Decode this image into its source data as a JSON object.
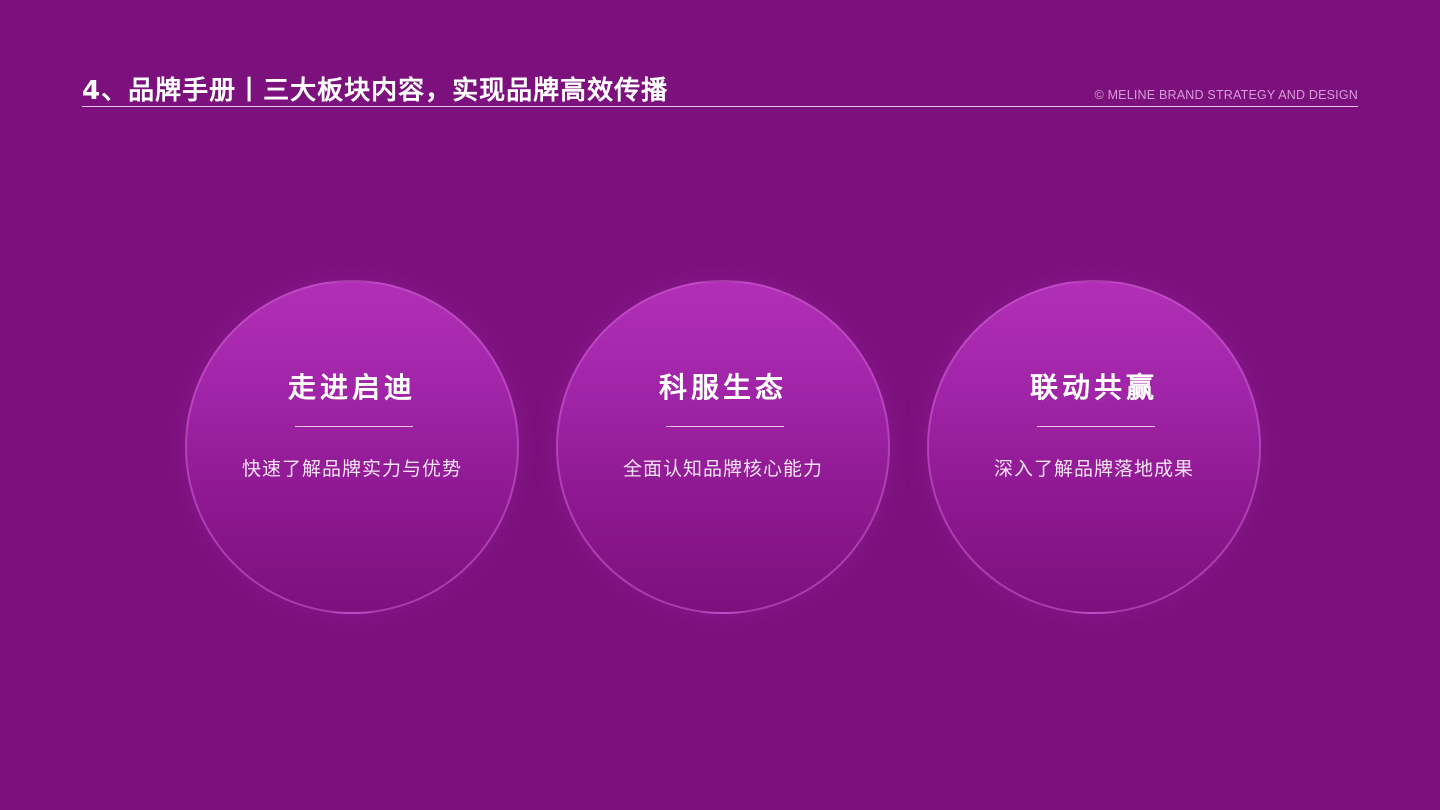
{
  "header": {
    "title": "4、品牌手册丨三大板块内容，实现品牌高效传播",
    "copyright": "© MELINE BRAND STRATEGY AND DESIGN"
  },
  "cards": [
    {
      "title": "走进启迪",
      "description": "快速了解品牌实力与优势"
    },
    {
      "title": "科服生态",
      "description": "全面认知品牌核心能力"
    },
    {
      "title": "联动共赢",
      "description": "深入了解品牌落地成果"
    }
  ],
  "colors": {
    "background": "#7c117d",
    "card_top": "#b02fb6",
    "card_bottom": "#7d117e",
    "copyright_text": "#d79bd9"
  }
}
